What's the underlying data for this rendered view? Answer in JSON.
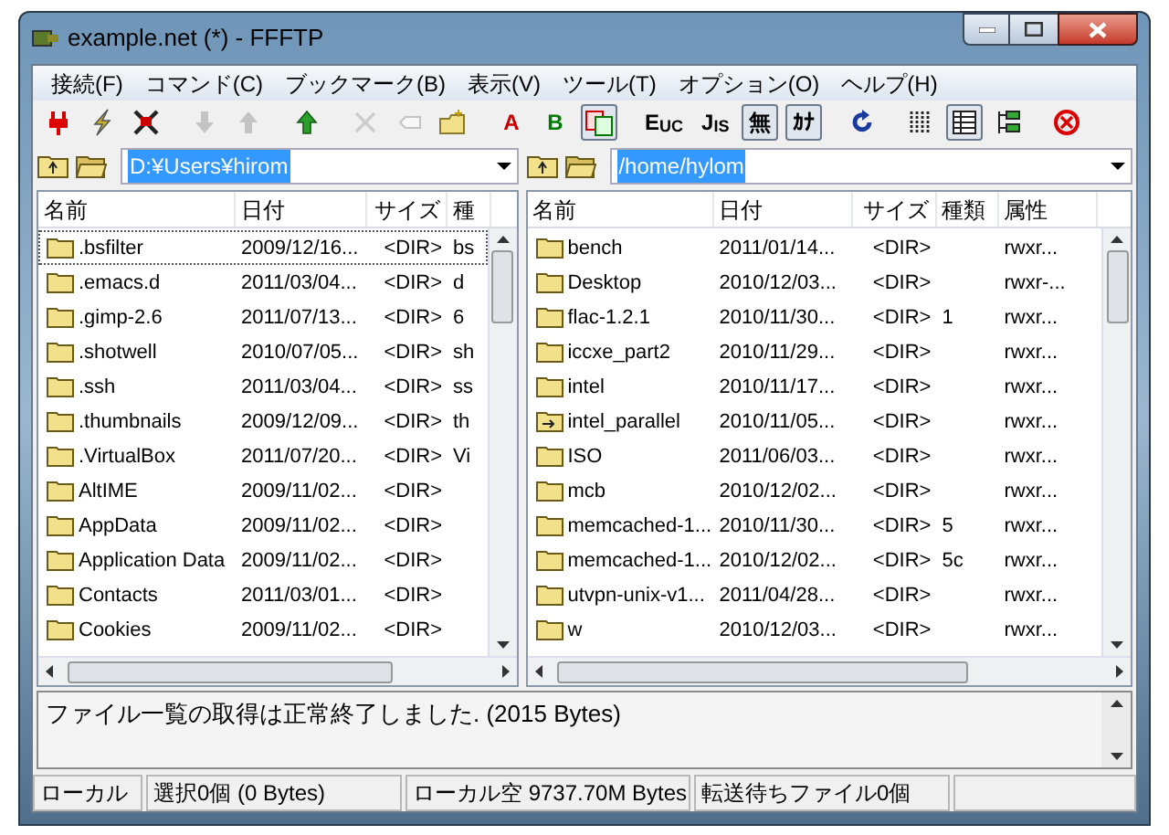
{
  "window": {
    "title": "example.net (*) - FFFTP"
  },
  "menu": [
    "接続(F)",
    "コマンド(C)",
    "ブックマーク(B)",
    "表示(V)",
    "ツール(T)",
    "オプション(O)",
    "ヘルプ(H)"
  ],
  "toolbar": [
    {
      "kind": "plug",
      "disabled": false,
      "pressed": false
    },
    {
      "kind": "bolt",
      "disabled": false,
      "pressed": false
    },
    {
      "kind": "cross-plug",
      "disabled": false,
      "pressed": false
    },
    {
      "kind": "down",
      "disabled": true,
      "pressed": false
    },
    {
      "kind": "up",
      "disabled": true,
      "pressed": false
    },
    {
      "kind": "parent",
      "disabled": false,
      "pressed": false
    },
    {
      "kind": "delete",
      "disabled": true,
      "pressed": false
    },
    {
      "kind": "rename",
      "disabled": true,
      "pressed": false
    },
    {
      "kind": "newfolder",
      "disabled": false,
      "pressed": false
    },
    {
      "kind": "text",
      "label": "A",
      "color": "#cc0000",
      "pressed": false,
      "disabled": false
    },
    {
      "kind": "text",
      "label": "B",
      "color": "#007a00",
      "pressed": false,
      "disabled": false
    },
    {
      "kind": "auto",
      "pressed": true,
      "disabled": false
    },
    {
      "kind": "text",
      "label": "E$_{UC}$",
      "color": "#000000",
      "pressed": false,
      "disabled": false
    },
    {
      "kind": "text",
      "label": "J$_{IS}$",
      "color": "#000000",
      "pressed": false,
      "disabled": false
    },
    {
      "kind": "text",
      "label": "無",
      "color": "#000000",
      "pressed": true,
      "disabled": false
    },
    {
      "kind": "text",
      "label": "ｶﾅ",
      "color": "#000000",
      "pressed": true,
      "disabled": false
    },
    {
      "kind": "refresh",
      "disabled": false,
      "pressed": false
    },
    {
      "kind": "list",
      "disabled": false,
      "pressed": false
    },
    {
      "kind": "details",
      "disabled": false,
      "pressed": true
    },
    {
      "kind": "tree",
      "disabled": false,
      "pressed": false
    },
    {
      "kind": "stop",
      "disabled": false,
      "pressed": false
    }
  ],
  "local": {
    "path": "D:¥Users¥hirom",
    "columns": [
      "名前",
      "日付",
      "サイズ",
      "種"
    ],
    "rows": [
      {
        "cells": [
          ".bsfilter",
          "2009/12/16...",
          "<DIR>",
          "bs"
        ],
        "focused": true,
        "kind": "folder"
      },
      {
        "cells": [
          ".emacs.d",
          "2011/03/04...",
          "<DIR>",
          "d"
        ],
        "focused": false,
        "kind": "folder"
      },
      {
        "cells": [
          ".gimp-2.6",
          "2011/07/13...",
          "<DIR>",
          "6"
        ],
        "focused": false,
        "kind": "folder"
      },
      {
        "cells": [
          ".shotwell",
          "2010/07/05...",
          "<DIR>",
          "sh"
        ],
        "focused": false,
        "kind": "folder"
      },
      {
        "cells": [
          ".ssh",
          "2011/03/04...",
          "<DIR>",
          "ss"
        ],
        "focused": false,
        "kind": "folder"
      },
      {
        "cells": [
          ".thumbnails",
          "2009/12/09...",
          "<DIR>",
          "th"
        ],
        "focused": false,
        "kind": "folder"
      },
      {
        "cells": [
          ".VirtualBox",
          "2011/07/20...",
          "<DIR>",
          "Vi"
        ],
        "focused": false,
        "kind": "folder"
      },
      {
        "cells": [
          "AltIME",
          "2009/11/02...",
          "<DIR>",
          ""
        ],
        "focused": false,
        "kind": "folder"
      },
      {
        "cells": [
          "AppData",
          "2009/11/02...",
          "<DIR>",
          ""
        ],
        "focused": false,
        "kind": "folder"
      },
      {
        "cells": [
          "Application Data",
          "2009/11/02...",
          "<DIR>",
          ""
        ],
        "focused": false,
        "kind": "folder"
      },
      {
        "cells": [
          "Contacts",
          "2011/03/01...",
          "<DIR>",
          ""
        ],
        "focused": false,
        "kind": "folder"
      },
      {
        "cells": [
          "Cookies",
          "2009/11/02...",
          "<DIR>",
          ""
        ],
        "focused": false,
        "kind": "folder"
      }
    ]
  },
  "remote": {
    "path": "/home/hylom",
    "columns": [
      "名前",
      "日付",
      "サイズ",
      "種類",
      "属性"
    ],
    "rows": [
      {
        "cells": [
          "bench",
          "2011/01/14...",
          "<DIR>",
          "",
          "rwxr..."
        ],
        "focused": false,
        "kind": "folder"
      },
      {
        "cells": [
          "Desktop",
          "2010/12/03...",
          "<DIR>",
          "",
          "rwxr-..."
        ],
        "focused": false,
        "kind": "folder"
      },
      {
        "cells": [
          "flac-1.2.1",
          "2010/11/30...",
          "<DIR>",
          "1",
          "rwxr..."
        ],
        "focused": false,
        "kind": "folder"
      },
      {
        "cells": [
          "iccxe_part2",
          "2010/11/29...",
          "<DIR>",
          "",
          "rwxr..."
        ],
        "focused": false,
        "kind": "folder"
      },
      {
        "cells": [
          "intel",
          "2010/11/17...",
          "<DIR>",
          "",
          "rwxr..."
        ],
        "focused": false,
        "kind": "folder"
      },
      {
        "cells": [
          "intel_parallel",
          "2010/11/05...",
          "<DIR>",
          "",
          "rwxr..."
        ],
        "focused": false,
        "kind": "link"
      },
      {
        "cells": [
          "ISO",
          "2011/06/03...",
          "<DIR>",
          "",
          "rwxr..."
        ],
        "focused": false,
        "kind": "folder"
      },
      {
        "cells": [
          "mcb",
          "2010/12/02...",
          "<DIR>",
          "",
          "rwxr..."
        ],
        "focused": false,
        "kind": "folder"
      },
      {
        "cells": [
          "memcached-1...",
          "2010/11/30...",
          "<DIR>",
          "5",
          "rwxr..."
        ],
        "focused": false,
        "kind": "folder"
      },
      {
        "cells": [
          "memcached-1...",
          "2010/12/02...",
          "<DIR>",
          "5c",
          "rwxr..."
        ],
        "focused": false,
        "kind": "folder"
      },
      {
        "cells": [
          "utvpn-unix-v1...",
          "2011/04/28...",
          "<DIR>",
          "",
          "rwxr..."
        ],
        "focused": false,
        "kind": "folder"
      },
      {
        "cells": [
          "w",
          "2010/12/03...",
          "<DIR>",
          "",
          "rwxr..."
        ],
        "focused": false,
        "kind": "folder"
      }
    ]
  },
  "log": "ファイル一覧の取得は正常終了しました. (2015 Bytes)",
  "status_bar": [
    "ローカル",
    "選択0個 (0 Bytes)",
    "ローカル空 9737.70M Bytes",
    "転送待ちファイル0個"
  ]
}
